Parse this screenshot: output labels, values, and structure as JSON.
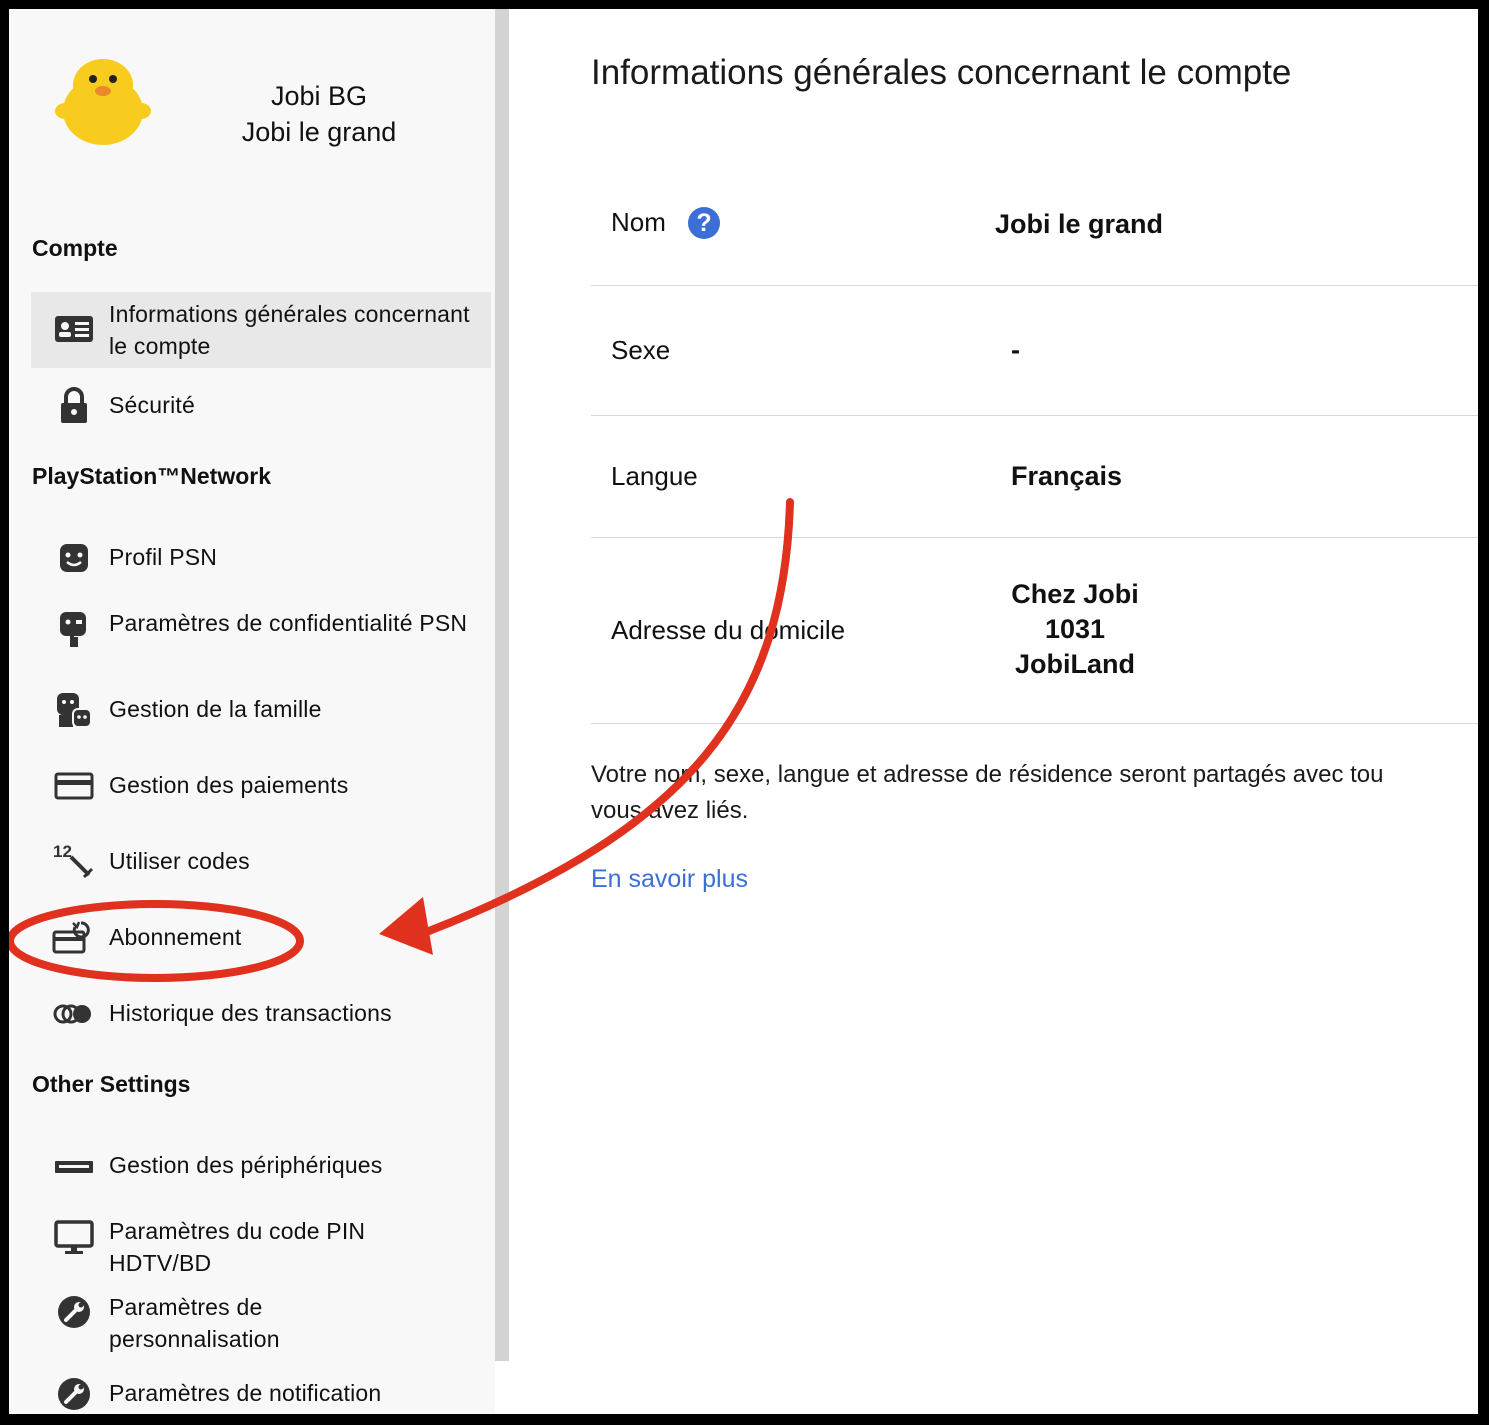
{
  "user": {
    "display_name": "Jobi BG",
    "full_name": "Jobi le grand"
  },
  "sidebar": {
    "sections": [
      {
        "title": "Compte"
      },
      {
        "title": "PlayStation™Network"
      },
      {
        "title": "Other Settings"
      }
    ],
    "items": [
      {
        "label": "Informations générales concernant le compte",
        "icon": "id-card-icon"
      },
      {
        "label": "Sécurité",
        "icon": "lock-icon"
      },
      {
        "label": "Profil PSN",
        "icon": "face-icon"
      },
      {
        "label": "Paramètres de confidentialité PSN",
        "icon": "privacy-icon"
      },
      {
        "label": "Gestion de la famille",
        "icon": "family-icon"
      },
      {
        "label": "Gestion des paiements",
        "icon": "credit-card-icon"
      },
      {
        "label": "Utiliser codes",
        "icon": "redeem-code-icon"
      },
      {
        "label": "Abonnement",
        "icon": "subscription-icon"
      },
      {
        "label": "Historique des transactions",
        "icon": "transactions-icon"
      },
      {
        "label": "Gestion des périphériques",
        "icon": "device-icon"
      },
      {
        "label": "Paramètres du code PIN HDTV/BD",
        "icon": "monitor-icon"
      },
      {
        "label": "Paramètres de personnalisation",
        "icon": "wrench-icon"
      },
      {
        "label": "Paramètres de notification",
        "icon": "wrench-icon"
      }
    ]
  },
  "main": {
    "title": "Informations générales concernant le compte",
    "rows": [
      {
        "label": "Nom",
        "value": "Jobi le grand",
        "has_help": true
      },
      {
        "label": "Sexe",
        "value": "-"
      },
      {
        "label": "Langue",
        "value": "Français"
      },
      {
        "label": "Adresse du domicile",
        "value_lines": [
          "Chez Jobi",
          "1031",
          "JobiLand"
        ]
      }
    ],
    "note": "Votre nom, sexe, langue et adresse de résidence seront partagés avec tous les services que vous avez liés.",
    "note_line1": "Votre nom, sexe, langue et adresse de résidence seront partagés avec tou",
    "note_line2": "vous avez liés.",
    "learn_more": "En savoir plus",
    "help_symbol": "?"
  },
  "colors": {
    "accent": "#3b6fd6",
    "annotation": "#e0301e",
    "sidebar_bg": "#f8f8f8"
  }
}
